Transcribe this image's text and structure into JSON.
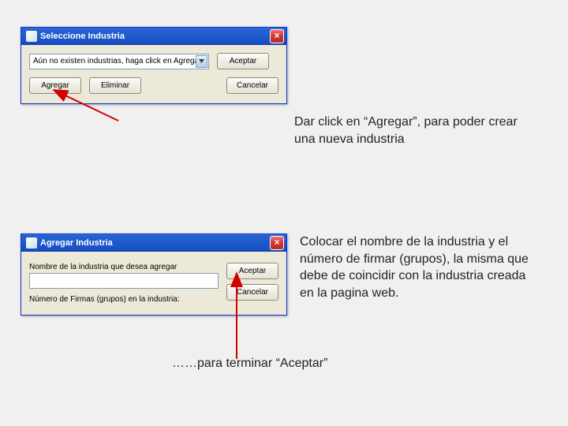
{
  "dialog1": {
    "title": "Seleccione Industria",
    "select_text": "Aún no existen industrias, haga click en Agregar",
    "btn_accept": "Aceptar",
    "btn_add": "Agregar",
    "btn_remove": "Eliminar",
    "btn_cancel": "Cancelar"
  },
  "dialog2": {
    "title": "Agregar Industria",
    "label_name": "Nombre de la industria que desea agregar",
    "label_count": "Número de Firmas (grupos) en la industria:",
    "btn_accept": "Aceptar",
    "btn_cancel": "Cancelar"
  },
  "annotations": {
    "a1": "Dar click en “Agregar”, para poder crear una nueva industria",
    "a2": "Colocar el nombre de la industria y el número de firmar (grupos), la misma que debe de coincidir con la industria creada  en la pagina web.",
    "final": "……para terminar “Aceptar”"
  },
  "icons": {
    "close": "×"
  }
}
